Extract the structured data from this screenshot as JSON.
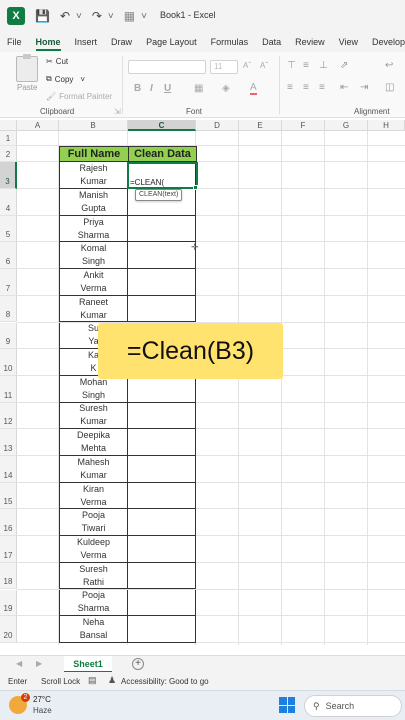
{
  "window": {
    "title": "Book1 - Excel",
    "logo_letter": "X"
  },
  "ribbon_tabs": [
    {
      "label": "File",
      "active": false
    },
    {
      "label": "Home",
      "active": true
    },
    {
      "label": "Insert",
      "active": false
    },
    {
      "label": "Draw",
      "active": false
    },
    {
      "label": "Page Layout",
      "active": false
    },
    {
      "label": "Formulas",
      "active": false
    },
    {
      "label": "Data",
      "active": false
    },
    {
      "label": "Review",
      "active": false
    },
    {
      "label": "View",
      "active": false
    },
    {
      "label": "Develope",
      "active": false
    }
  ],
  "ribbon": {
    "clipboard": {
      "paste_label": "Paste",
      "cut_label": "Cut",
      "copy_label": "Copy",
      "format_painter_label": "Format Painter",
      "group_label": "Clipboard"
    },
    "font": {
      "font_size": "11",
      "group_label": "Font"
    },
    "alignment": {
      "group_label": "Alignment"
    }
  },
  "grid": {
    "columns": [
      "A",
      "B",
      "C",
      "D",
      "E",
      "F",
      "G",
      "H"
    ],
    "selected_column": "C",
    "selected_row": 3,
    "rows": [
      "1",
      "2",
      "3",
      "4",
      "5",
      "6",
      "7",
      "8",
      "9",
      "10",
      "11",
      "12",
      "13",
      "14",
      "15",
      "16",
      "17",
      "18",
      "19",
      "20"
    ]
  },
  "table": {
    "header_full_name": "Full Name",
    "header_clean_data": "Clean Data",
    "names": [
      [
        "Rajesh",
        "Kumar"
      ],
      [
        "Manish",
        "Gupta"
      ],
      [
        "Priya",
        "Sharma"
      ],
      [
        "Komal",
        "Singh"
      ],
      [
        "Ankit",
        "Verma"
      ],
      [
        "Raneet",
        "Kumar"
      ],
      [
        "Su",
        "Ya"
      ],
      [
        "Ka",
        "K"
      ],
      [
        "Mohan",
        "Singh"
      ],
      [
        "Suresh",
        "Kumar"
      ],
      [
        "Deepika",
        "Mehta"
      ],
      [
        "Mahesh",
        "Kumar"
      ],
      [
        "Kiran",
        "Verma"
      ],
      [
        "Pooja",
        "Tiwari"
      ],
      [
        "Kuldeep",
        "Verma"
      ],
      [
        "Suresh",
        "Rathi"
      ],
      [
        "Pooja",
        "Sharma"
      ],
      [
        "Neha",
        "Bansal"
      ]
    ],
    "active_cell_input": "=CLEAN(",
    "function_tooltip": "CLEAN(text)"
  },
  "overlay": {
    "caption": "=Clean(B3)"
  },
  "sheets": {
    "active_tab": "Sheet1",
    "add_label": "+"
  },
  "status": {
    "mode": "Enter",
    "scroll_lock": "Scroll Lock",
    "accessibility": "Accessibility: Good to go"
  },
  "taskbar": {
    "weather_badge": "2",
    "temperature": "27°C",
    "condition": "Haze",
    "search_label": "Search"
  },
  "colors": {
    "excel_green": "#107c41",
    "header_fill": "#92d050",
    "banner_fill": "#ffe36e"
  }
}
